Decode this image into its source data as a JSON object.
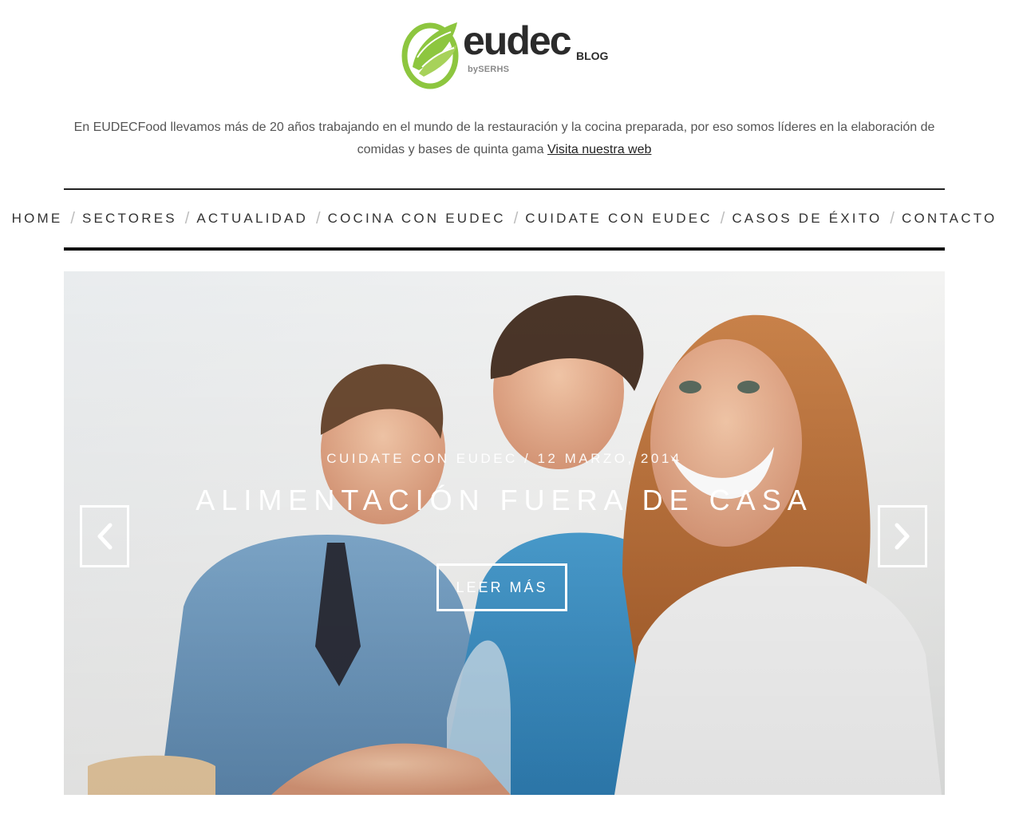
{
  "brand": {
    "name": "eudec",
    "byline": "bySERHS",
    "tag": "BLOG",
    "color_green": "#8dc63f"
  },
  "intro": {
    "text": "En EUDECFood llevamos más de 20 años trabajando en el mundo de la restauración y la cocina preparada, por eso somos líderes en la elaboración de comidas y bases de quinta gama",
    "link_label": "Visita nuestra web"
  },
  "nav": {
    "items": [
      {
        "label": "HOME"
      },
      {
        "label": "SECTORES"
      },
      {
        "label": "ACTUALIDAD"
      },
      {
        "label": "COCINA CON EUDEC"
      },
      {
        "label": "CUIDATE CON EUDEC"
      },
      {
        "label": "CASOS DE ÉXITO"
      },
      {
        "label": "CONTACTO"
      }
    ],
    "separator": "/"
  },
  "hero": {
    "meta": "CUIDATE CON EUDEC / 12 MARZO, 2014",
    "title": "ALIMENTACIÓN FUERA DE CASA",
    "button_label": "LEER MÁS",
    "prev_icon": "chevron-left-icon",
    "next_icon": "chevron-right-icon"
  }
}
